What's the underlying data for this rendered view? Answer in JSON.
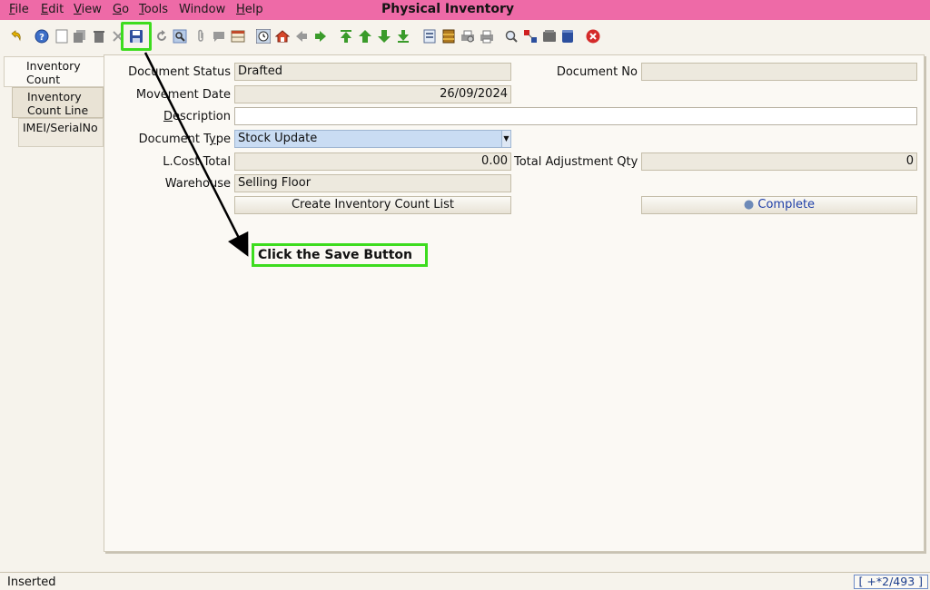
{
  "window": {
    "title": "Physical Inventory"
  },
  "menu": {
    "file": {
      "ul": "F",
      "rest": "ile"
    },
    "edit": {
      "ul": "E",
      "rest": "dit"
    },
    "view": {
      "ul": "V",
      "rest": "iew"
    },
    "go": {
      "ul": "G",
      "rest": "o"
    },
    "tools": {
      "ul": "T",
      "rest": "ools"
    },
    "window": {
      "pre": "Window"
    },
    "help": {
      "ul": "H",
      "rest": "elp"
    }
  },
  "toolbar": {
    "icons": [
      "undo-icon",
      "help-icon",
      "new-record-icon",
      "copy-record-icon",
      "delete-icon",
      "delete-selection-icon",
      "save-icon",
      "refresh-icon",
      "find-icon",
      "attachment-icon",
      "chat-icon",
      "grid-toggle-icon",
      "history-icon",
      "home-icon",
      "back-icon",
      "forward-icon",
      "first-record-icon",
      "previous-record-icon",
      "next-record-icon",
      "last-record-icon",
      "report-icon",
      "archive-icon",
      "print-preview-icon",
      "print-icon",
      "zoom-across-icon",
      "request-icon",
      "product-info-icon",
      "active-workflows-icon",
      "end-icon"
    ]
  },
  "tabs": {
    "inventory_count": "Inventory Count",
    "count_line": "Inventory Count Line",
    "imei": "IMEI/SerialNo"
  },
  "form": {
    "document_status": {
      "label": "Document Status",
      "value": "Drafted"
    },
    "document_no": {
      "label": "Document No",
      "value": ""
    },
    "movement_date": {
      "label": "Movement Date",
      "value": "26/09/2024"
    },
    "description": {
      "label_ul": "D",
      "label_rest": "escription",
      "value": ""
    },
    "document_type": {
      "label_pre": "Document T",
      "label_ul": "y",
      "label_rest": "pe",
      "value": "Stock Update"
    },
    "lcost_total": {
      "label": "L.Cost Total",
      "value": "0.00"
    },
    "total_adjustment_qty": {
      "label": "Total Adjustment Qty",
      "value": "0"
    },
    "warehouse": {
      "label": "Warehouse",
      "value": "Selling Floor"
    },
    "create_list_button": "Create Inventory Count List",
    "complete_button": "Complete"
  },
  "annotation": {
    "text": "Click the Save Button",
    "color": "#3ddc1e"
  },
  "status": {
    "text": "Inserted",
    "record_info": "[ +*2/493 ]"
  },
  "colors": {
    "menubar": "#ee6aa7",
    "background": "#f6f3ec",
    "highlight": "#3ddc1e"
  }
}
